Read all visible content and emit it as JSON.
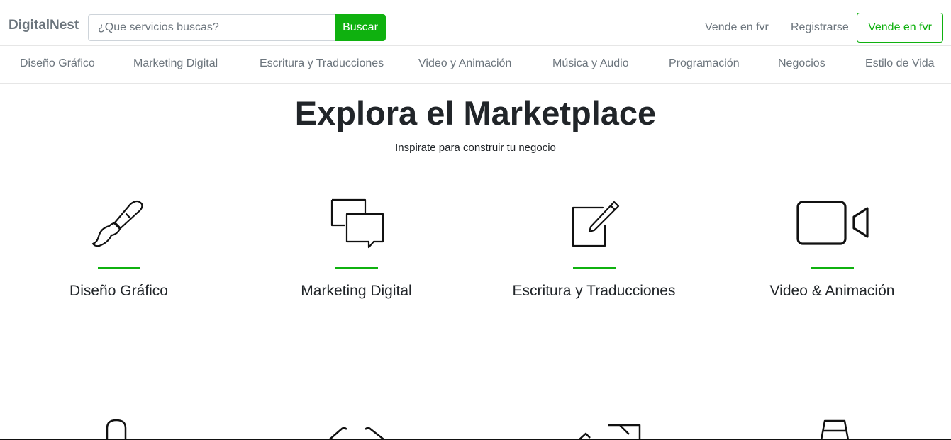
{
  "brand": "DigitalNest",
  "search": {
    "placeholder": "¿Que servicios buscas?",
    "button_label": "Buscar"
  },
  "header_links": {
    "sell": "Vende en fvr",
    "register": "Registrarse",
    "sell_button": "Vende en fvr"
  },
  "categories": [
    "Diseño Gráfico",
    "Marketing Digital",
    "Escritura y Traducciones",
    "Video y Animación",
    "Música y Audio",
    "Programación",
    "Negocios",
    "Estilo de Vida"
  ],
  "hero": {
    "title": "Explora el Marketplace",
    "subtitle": "Inspirate para construir tu negocio"
  },
  "tiles": [
    {
      "label": "Diseño Gráfico",
      "icon": "paintbrush-icon"
    },
    {
      "label": "Marketing Digital",
      "icon": "chat-bubbles-icon"
    },
    {
      "label": "Escritura y Traducciones",
      "icon": "edit-pencil-icon"
    },
    {
      "label": "Video & Animación",
      "icon": "video-camera-icon"
    }
  ],
  "colors": {
    "accent": "#0fb10f",
    "text": "#212529",
    "muted": "#6c757d"
  }
}
